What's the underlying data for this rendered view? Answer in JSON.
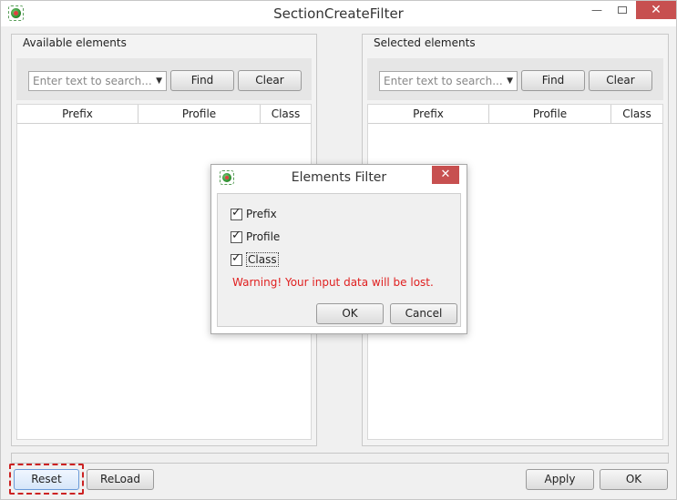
{
  "window": {
    "title": "SectionCreateFilter",
    "minimize_glyph": "—",
    "close_glyph": "✕"
  },
  "left_panel": {
    "header": "Available elements",
    "search_placeholder": "Enter text to search...",
    "find_label": "Find",
    "clear_label": "Clear",
    "columns": [
      "Prefix",
      "Profile",
      "Class"
    ]
  },
  "right_panel": {
    "header": "Selected elements",
    "search_placeholder": "Enter text to search...",
    "find_label": "Find",
    "clear_label": "Clear",
    "columns": [
      "Prefix",
      "Profile",
      "Class"
    ]
  },
  "footer": {
    "reset_label": "Reset",
    "reload_label": "ReLoad",
    "apply_label": "Apply",
    "ok_label": "OK"
  },
  "dialog": {
    "title": "Elements Filter",
    "close_glyph": "✕",
    "checkboxes": [
      {
        "label": "Prefix",
        "checked": true
      },
      {
        "label": "Profile",
        "checked": true
      },
      {
        "label": "Class",
        "checked": true
      }
    ],
    "warning": "Warning!  Your input data will be lost.",
    "ok_label": "OK",
    "cancel_label": "Cancel"
  },
  "colors": {
    "close_button": "#c75050",
    "warning_text": "#e02020",
    "focus_outline": "#cc2222"
  },
  "icons": {
    "app": "app-logo-icon",
    "dropdown": "chevron-down-icon",
    "check": "checkmark-icon"
  }
}
